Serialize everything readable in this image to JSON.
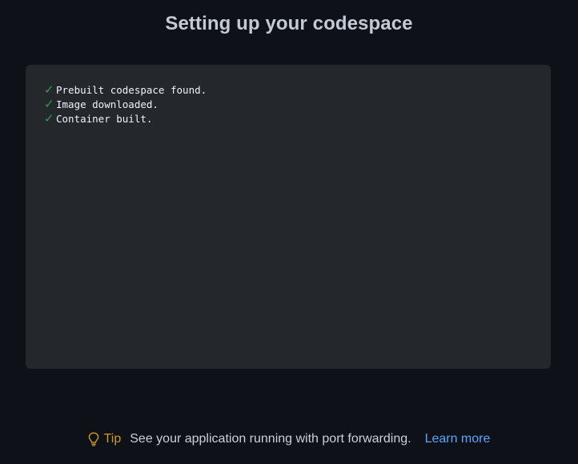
{
  "header": {
    "title": "Setting up your codespace"
  },
  "log": {
    "lines": [
      {
        "status": "success",
        "icon": "check-icon",
        "text": "Prebuilt codespace found."
      },
      {
        "status": "success",
        "icon": "check-icon",
        "text": "Image downloaded."
      },
      {
        "status": "success",
        "icon": "check-icon",
        "text": "Container built."
      }
    ],
    "check_glyph": "✓",
    "colors": {
      "panel_background": "#24282d",
      "check": "#2ea043",
      "text": "#f0f3f6"
    }
  },
  "tip": {
    "icon": "lightbulb-icon",
    "label": "Tip",
    "text": "See your application running with port forwarding.",
    "link_label": "Learn more",
    "colors": {
      "label": "#d29922",
      "link": "#58a6ff"
    }
  },
  "theme": {
    "page_background": "#0e1117"
  }
}
